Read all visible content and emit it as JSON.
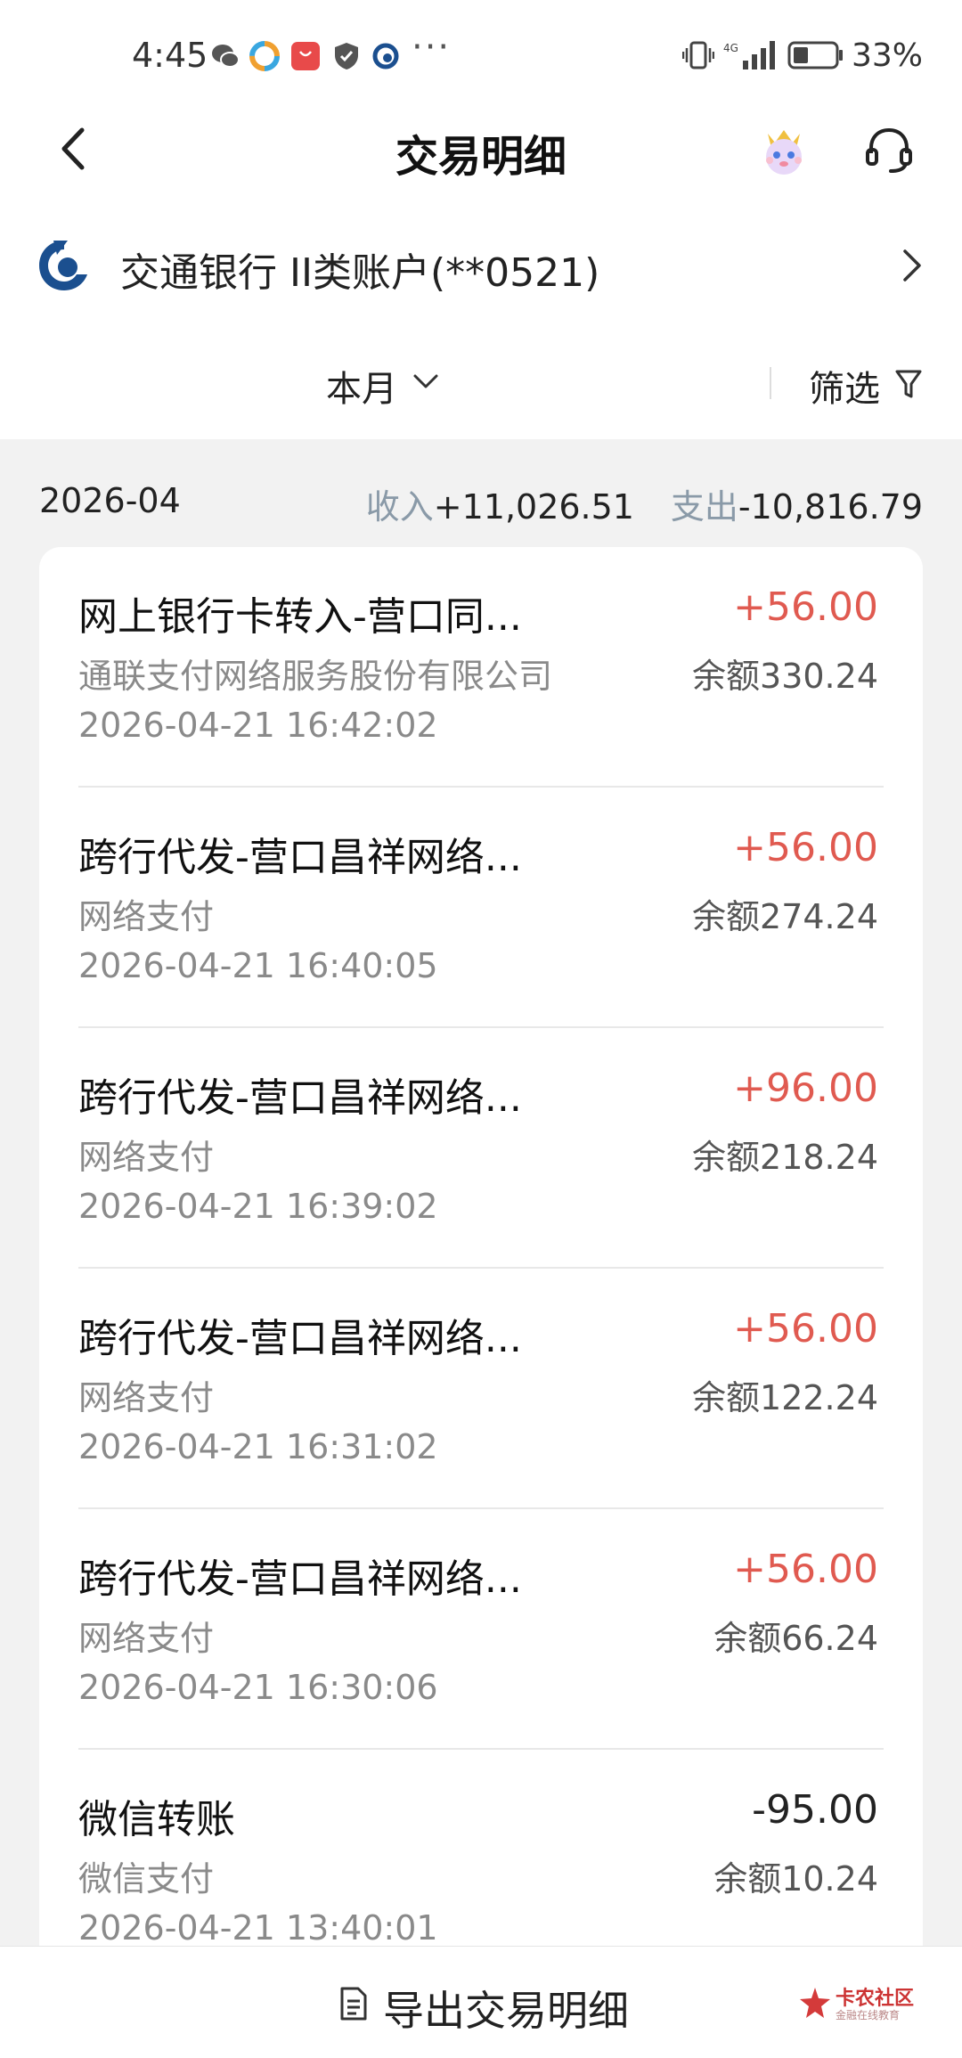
{
  "status_bar": {
    "time": "4:45",
    "dots": "···",
    "battery_percent": "33%"
  },
  "nav": {
    "title": "交易明细"
  },
  "account": {
    "name": "交通银行 II类账户(**0521)"
  },
  "filter": {
    "period": "本月",
    "filter_label": "筛选"
  },
  "summary": {
    "month": "2026-04",
    "income_label": "收入",
    "income_value": "+11,026.51",
    "expense_label": "支出",
    "expense_value": "-10,816.79"
  },
  "transactions": [
    {
      "title": "网上银行卡转入-营口同...",
      "counterparty": "通联支付网络服务股份有限公司",
      "time": "2026-04-21 16:42:02",
      "amount": "+56.00",
      "balance": "余额330.24",
      "direction": "in"
    },
    {
      "title": "跨行代发-营口昌祥网络...",
      "counterparty": "网络支付",
      "time": "2026-04-21 16:40:05",
      "amount": "+56.00",
      "balance": "余额274.24",
      "direction": "in"
    },
    {
      "title": "跨行代发-营口昌祥网络...",
      "counterparty": "网络支付",
      "time": "2026-04-21 16:39:02",
      "amount": "+96.00",
      "balance": "余额218.24",
      "direction": "in"
    },
    {
      "title": "跨行代发-营口昌祥网络...",
      "counterparty": "网络支付",
      "time": "2026-04-21 16:31:02",
      "amount": "+56.00",
      "balance": "余额122.24",
      "direction": "in"
    },
    {
      "title": "跨行代发-营口昌祥网络...",
      "counterparty": "网络支付",
      "time": "2026-04-21 16:30:06",
      "amount": "+56.00",
      "balance": "余额66.24",
      "direction": "in"
    },
    {
      "title": "微信转账",
      "counterparty": "微信支付",
      "time": "2026-04-21 13:40:01",
      "amount": "-95.00",
      "balance": "余额10.24",
      "direction": "out"
    }
  ],
  "bottom": {
    "export_label": "导出交易明细",
    "watermark_text": "卡农社区",
    "watermark_sub": "金融在线教育"
  },
  "colors": {
    "income_amount": "#e05a50",
    "summary_label": "#8a9aa8",
    "brand_blue": "#1b4f8f"
  },
  "icons": [
    "back-arrow-icon",
    "mascot-icon",
    "customer-service-icon",
    "bank-logo-icon",
    "chevron-right-icon",
    "chevron-down-icon",
    "filter-funnel-icon",
    "document-icon"
  ]
}
